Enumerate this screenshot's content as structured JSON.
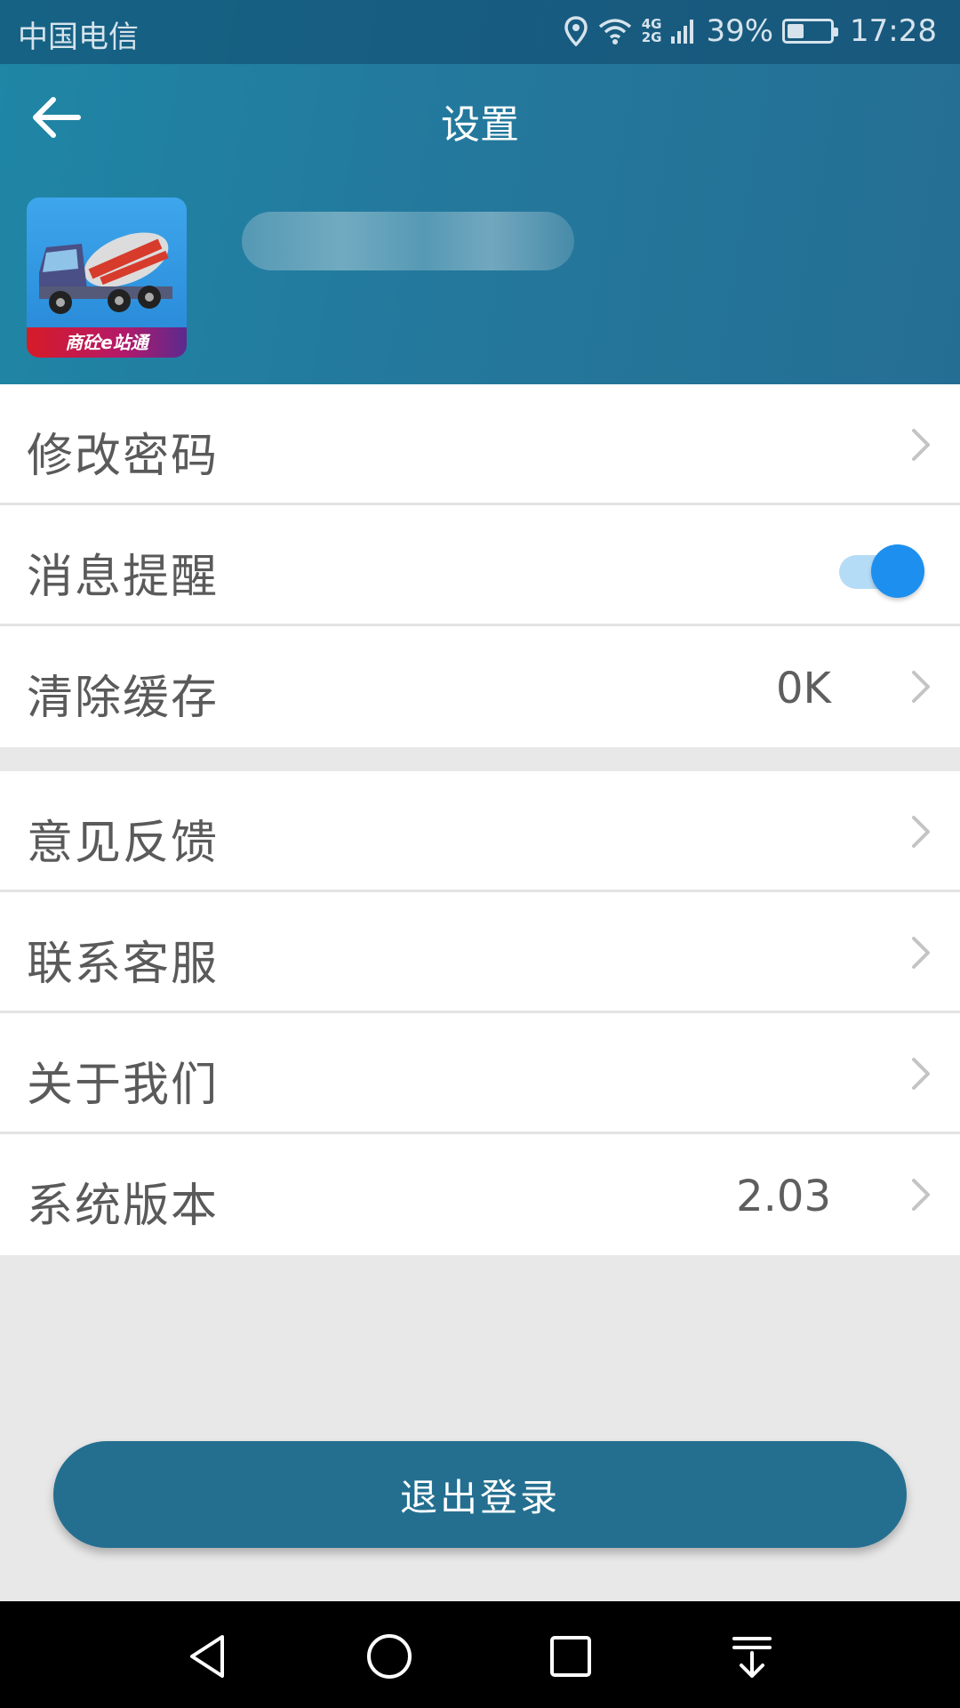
{
  "status_bar": {
    "carrier": "中国电信",
    "network_top": "4G",
    "network_bottom": "2G",
    "battery": "39%",
    "battery_level": 0.39,
    "time": "17:28"
  },
  "toolbar": {
    "title": "设置"
  },
  "profile": {
    "logo_text": "商砼e站通"
  },
  "settings_group_1": [
    {
      "label": "修改密码",
      "value": "",
      "control": "chevron"
    },
    {
      "label": "消息提醒",
      "value": "",
      "control": "toggle",
      "toggle_on": true
    },
    {
      "label": "清除缓存",
      "value": "0K",
      "control": "chevron"
    }
  ],
  "settings_group_2": [
    {
      "label": "意见反馈",
      "value": "",
      "control": "chevron"
    },
    {
      "label": "联系客服",
      "value": "",
      "control": "chevron"
    },
    {
      "label": "关于我们",
      "value": "",
      "control": "chevron"
    },
    {
      "label": "系统版本",
      "value": "2.03",
      "control": "chevron"
    }
  ],
  "logout": {
    "label": "退出登录"
  },
  "colors": {
    "header": "#23799d",
    "toggle_on": "#1d8fee",
    "logout_button": "#246f90"
  },
  "icons": [
    "location-icon",
    "wifi-icon",
    "signal-icon",
    "battery-icon",
    "back-arrow-icon",
    "chevron-right-icon",
    "nav-back-icon",
    "nav-home-icon",
    "nav-recents-icon",
    "nav-notification-icon"
  ]
}
